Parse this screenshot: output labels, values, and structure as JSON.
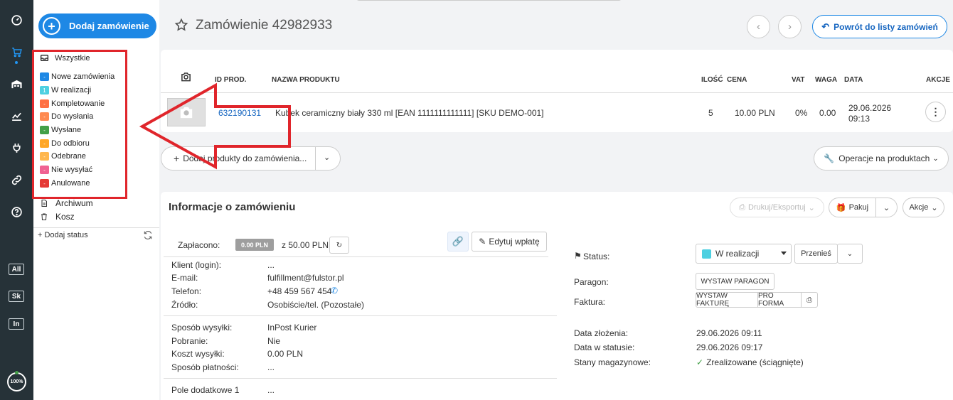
{
  "header": {
    "add_order_label": "Dodaj zamówienie",
    "order_title": "Zamówienie 42982933",
    "back_label": "Powrót do listy zamówień"
  },
  "rail": {
    "tags": [
      "All",
      "Sk",
      "In"
    ],
    "progress_label": "100%"
  },
  "sidebar": {
    "all_label": "Wszystkie",
    "statuses": [
      {
        "label": "Nowe zamówienia",
        "color": "#1e88e5",
        "mark": "-"
      },
      {
        "label": "W realizacji",
        "color": "#4dd0e1",
        "mark": "1"
      },
      {
        "label": "Kompletowanie",
        "color": "#ff7043",
        "mark": "-"
      },
      {
        "label": "Do wysłania",
        "color": "#ff8a50",
        "mark": "-"
      },
      {
        "label": "Wysłane",
        "color": "#43a047",
        "mark": "-"
      },
      {
        "label": "Do odbioru",
        "color": "#ffa726",
        "mark": "-"
      },
      {
        "label": "Odebrane",
        "color": "#ffb74d",
        "mark": "-"
      },
      {
        "label": "Nie wysyłać",
        "color": "#f06292",
        "mark": "-"
      },
      {
        "label": "Anulowane",
        "color": "#e53935",
        "mark": "-"
      }
    ],
    "archive_label": "Archiwum",
    "trash_label": "Kosz",
    "add_status_label": "+ Dodaj status"
  },
  "products": {
    "columns": {
      "id": "ID PROD.",
      "name": "NAZWA PRODUKTU",
      "qty": "ILOŚĆ",
      "price": "CENA",
      "vat": "VAT",
      "weight": "WAGA",
      "date": "DATA",
      "actions": "AKCJE"
    },
    "row": {
      "id": "632190131",
      "name": "Kubek ceramiczny biały 330 ml [EAN 1111111111111] [SKU DEMO-001]",
      "qty": "5",
      "price": "10.00 PLN",
      "vat": "0%",
      "weight": "0.00",
      "date": "29.06.2026",
      "time": "09:13"
    },
    "add_products_label": "Dodaj produkty do zamówienia...",
    "operations_label": "Operacje na produktach"
  },
  "info": {
    "title": "Informacje o zamówieniu",
    "print_label": "Drukuj/Eksportuj",
    "pack_label": "Pakuj",
    "actions_label": "Akcje",
    "paid_label": "Zapłacono:",
    "paid_value": "0.00 PLN",
    "paid_total": "z 50.00 PLN",
    "edit_payment_label": "Edytuj wpłatę",
    "client_label": "Klient (login):",
    "client_value": "...",
    "email_label": "E-mail:",
    "email_value": "fulfillment@fulstor.pl",
    "phone_label": "Telefon:",
    "phone_value": "+48 459 567 454",
    "source_label": "Źródło:",
    "source_value": "Osobiście/tel. (Pozostałe)",
    "shipping_label": "Sposób wysyłki:",
    "shipping_value": "InPost Kurier",
    "cod_label": "Pobranie:",
    "cod_value": "Nie",
    "ship_cost_label": "Koszt wysyłki:",
    "ship_cost_value": "0.00 PLN",
    "payment_label": "Sposób płatności:",
    "payment_value": "...",
    "extra1_label": "Pole dodatkowe 1",
    "extra1_value": "...",
    "status_label": "Status:",
    "status_value": "W realizacji",
    "move_label": "Przenieś",
    "receipt_label": "Paragon:",
    "receipt_btn": "WYSTAW PARAGON",
    "invoice_label": "Faktura:",
    "invoice_btn": "WYSTAW FAKTURĘ",
    "proforma_btn": "PRO FORMA",
    "created_label": "Data złożenia:",
    "created_value": "29.06.2026 09:11",
    "status_date_label": "Data w statusie:",
    "status_date_value": "29.06.2026 09:17",
    "stock_label": "Stany magazynowe:",
    "stock_value": "Zrealizowane (ściągnięte)"
  }
}
